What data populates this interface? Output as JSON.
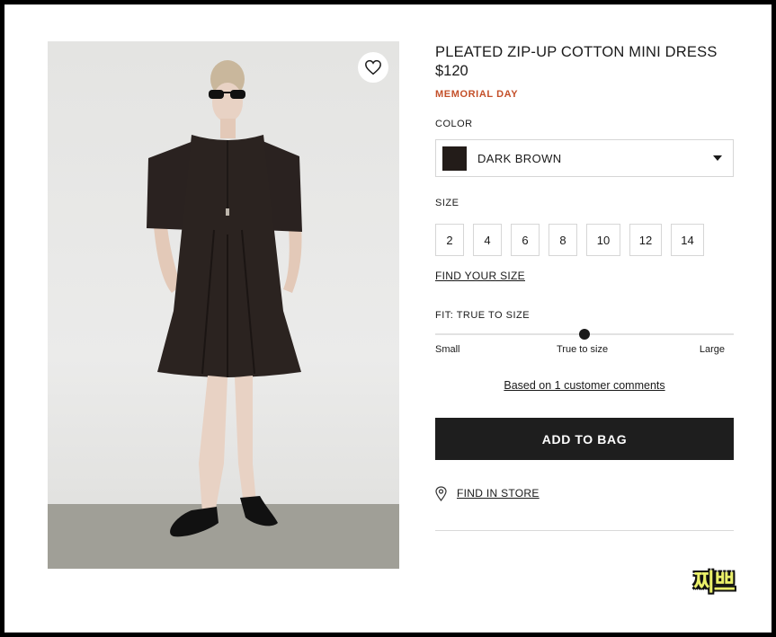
{
  "product": {
    "title": "PLEATED ZIP-UP COTTON MINI DRESS",
    "price": "$120",
    "promo": "MEMORIAL DAY"
  },
  "color": {
    "label": "COLOR",
    "selected": "DARK BROWN",
    "swatch_hex": "#231c19"
  },
  "size": {
    "label": "SIZE",
    "options": [
      "2",
      "4",
      "6",
      "8",
      "10",
      "12",
      "14"
    ],
    "find_link": "FIND YOUR SIZE"
  },
  "fit": {
    "label": "FIT: TRUE TO SIZE",
    "level": 0.5,
    "low": "Small",
    "mid": "True to size",
    "high": "Large",
    "comments_link": "Based on 1 customer comments"
  },
  "actions": {
    "add_to_bag": "ADD TO BAG",
    "find_in_store": "FIND IN STORE"
  },
  "icons": {
    "wishlist": "heart-icon",
    "store": "location-pin-icon"
  },
  "watermark": "찌쁘",
  "colors": {
    "accent": "#c4502a",
    "button": "#1e1e1e"
  }
}
